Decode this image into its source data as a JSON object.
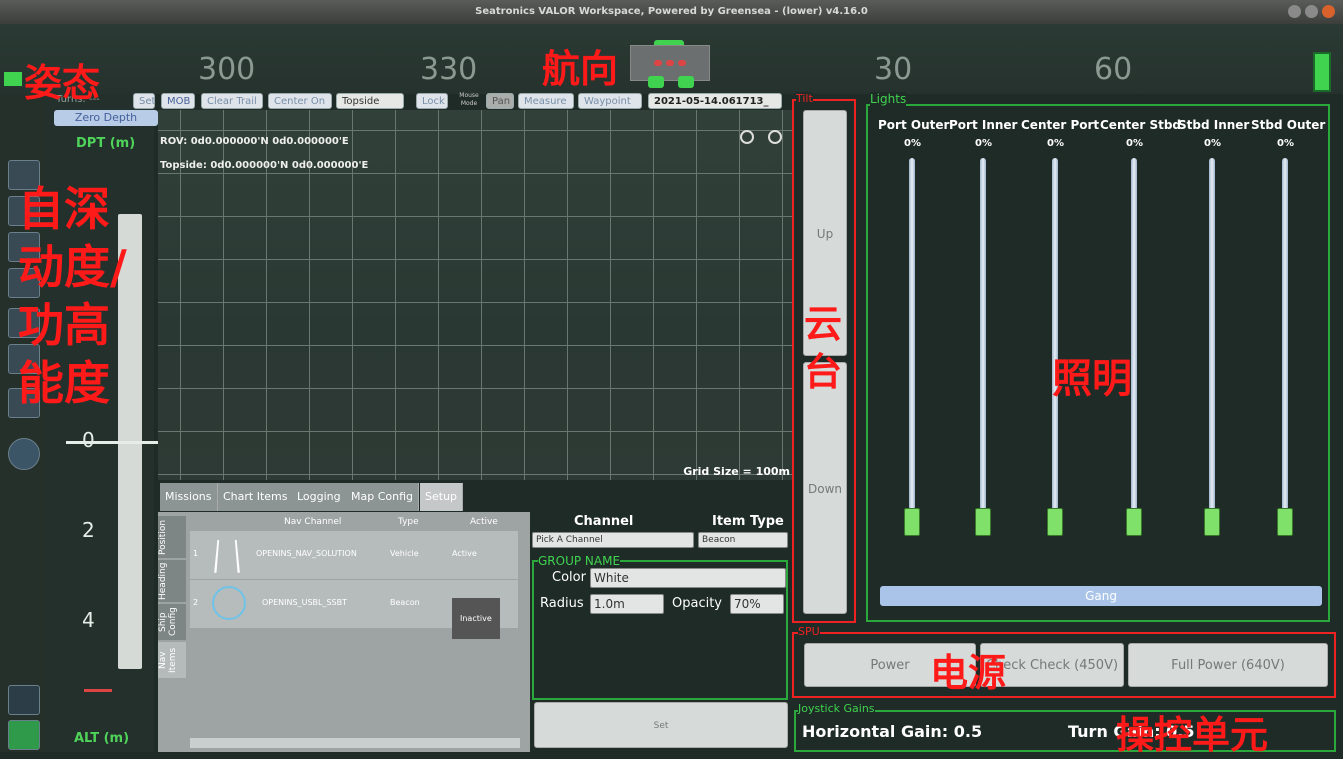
{
  "window": {
    "title": "Seatronics VALOR Workspace, Powered by Greensea - (lower) v4.16.0"
  },
  "heading_tape": {
    "ticks": [
      "300",
      "330",
      "30",
      "60"
    ]
  },
  "attitude": {
    "turns_label": "Turns: ---",
    "zero_depth": "Zero Depth",
    "dpt_label": "DPT (m)",
    "alt_label": "ALT (m)",
    "scale": [
      "0",
      "2",
      "4"
    ]
  },
  "toolbar": {
    "set": "Set",
    "mob": "MOB",
    "clear_trail": "Clear Trail",
    "center_on": "Center On",
    "center_target": "Topside",
    "lock": "Lock",
    "mouse_mode": "Mouse Mode",
    "pan": "Pan",
    "measure": "Measure",
    "waypoint": "Waypoint",
    "datetime": "2021-05-14.061713_"
  },
  "map": {
    "rov": "ROV: 0d0.000000'N 0d0.000000'E",
    "topside": "Topside: 0d0.000000'N 0d0.000000'E",
    "grid_size": "Grid Size = 100m"
  },
  "tabs": [
    "Missions",
    "Chart Items",
    "Logging",
    "Map Config",
    "Setup"
  ],
  "side_tabs": [
    "Position",
    "Heading",
    "Ship Config",
    "Nav Items"
  ],
  "nav_table": {
    "headers": [
      "Nav Channel",
      "Type",
      "Active"
    ],
    "rows": [
      {
        "idx": "1",
        "channel": "OPENINS_NAV_SOLUTION",
        "type": "Vehicle",
        "active": "Active"
      },
      {
        "idx": "2",
        "channel": "OPENINS_USBL_SSBT",
        "type": "Beacon",
        "active": "Inactive"
      }
    ]
  },
  "group": {
    "channel_label": "Channel",
    "item_type_label": "Item Type",
    "channel_value": "Pick A Channel",
    "item_type_value": "Beacon",
    "group_name": "GROUP NAME",
    "color_label": "Color",
    "color_value": "White",
    "radius_label": "Radius",
    "radius_value": "1.0m",
    "opacity_label": "Opacity",
    "opacity_value": "70%",
    "set_label": "Set"
  },
  "tilt": {
    "title": "Tilt",
    "up": "Up",
    "down": "Down"
  },
  "lights": {
    "title": "Lights",
    "channels": [
      {
        "name": "Port Outer",
        "value": "0%"
      },
      {
        "name": "Port Inner",
        "value": "0%"
      },
      {
        "name": "Center Port",
        "value": "0%"
      },
      {
        "name": "Center Stbd",
        "value": "0%"
      },
      {
        "name": "Stbd Inner",
        "value": "0%"
      },
      {
        "name": "Stbd Outer",
        "value": "0%"
      }
    ],
    "gang": "Gang"
  },
  "spu": {
    "title": "SPU",
    "power": "Power",
    "check": "Check Check (450V)",
    "full": "Full Power (640V)"
  },
  "joystick": {
    "title": "Joystick Gains",
    "horizontal": "Horizontal Gain: 0.5",
    "turn": "Turn Gain: 0.5"
  },
  "annotations": {
    "attitude": "姿态",
    "heading": "航向",
    "auto_func": "自动功能",
    "depth_alt": "深度/高度",
    "gimbal": "云台",
    "lighting": "照明",
    "power": "电源",
    "control_unit": "操控单元"
  },
  "colors": {
    "accent_green": "#2ba83c",
    "annotation_red": "#ff1a1a",
    "knob_green": "#7fe06a"
  }
}
